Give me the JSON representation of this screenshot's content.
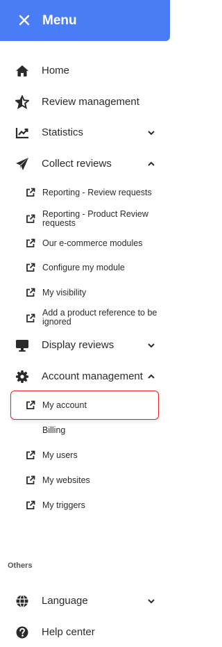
{
  "header": {
    "title": "Menu"
  },
  "nav": {
    "home": "Home",
    "review_management": "Review management",
    "statistics": "Statistics",
    "collect_reviews": "Collect reviews",
    "display_reviews": "Display reviews",
    "account_management": "Account management",
    "language": "Language",
    "help_center": "Help center"
  },
  "collect_sub": [
    "Reporting - Review requests",
    "Reporting - Product Review requests",
    "Our e-commerce modules",
    "Configure my module",
    "My visibility",
    "Add a product reference to be ignored"
  ],
  "account_sub": [
    "My account",
    "Billing",
    "My users",
    "My websites",
    "My triggers"
  ],
  "others_title": "Others",
  "colors": {
    "header": "#4a7cf5",
    "highlight": "#e0242a"
  }
}
